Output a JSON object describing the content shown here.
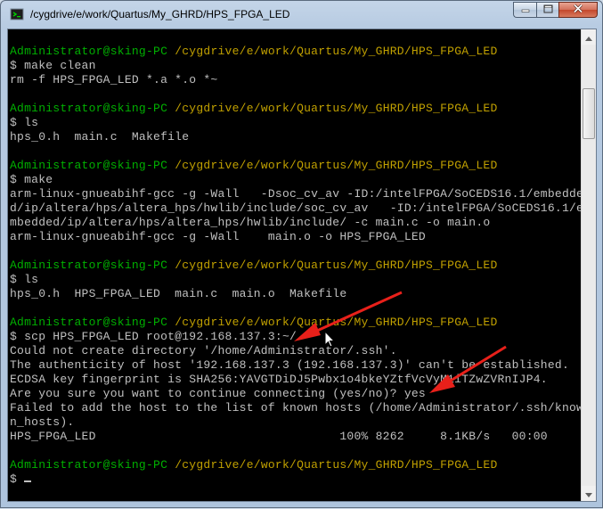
{
  "window": {
    "title": "/cygdrive/e/work/Quartus/My_GHRD/HPS_FPGA_LED",
    "icon": "cygwin-terminal-icon",
    "controls": [
      "minimize-icon",
      "maximize-icon",
      "close-icon"
    ]
  },
  "terminal": {
    "lines": [
      {
        "user": "Administrator@sking-PC",
        "path": "/cygdrive/e/work/Quartus/My_GHRD/HPS_FPGA_LED"
      },
      {
        "text": "$ make clean"
      },
      {
        "text": "rm -f HPS_FPGA_LED *.a *.o *~"
      },
      {
        "text": ""
      },
      {
        "user": "Administrator@sking-PC",
        "path": "/cygdrive/e/work/Quartus/My_GHRD/HPS_FPGA_LED"
      },
      {
        "text": "$ ls"
      },
      {
        "text": "hps_0.h  main.c  Makefile"
      },
      {
        "text": ""
      },
      {
        "user": "Administrator@sking-PC",
        "path": "/cygdrive/e/work/Quartus/My_GHRD/HPS_FPGA_LED"
      },
      {
        "text": "$ make"
      },
      {
        "text": "arm-linux-gnueabihf-gcc -g -Wall   -Dsoc_cv_av -ID:/intelFPGA/SoCEDS16.1/embedde"
      },
      {
        "text": "d/ip/altera/hps/altera_hps/hwlib/include/soc_cv_av   -ID:/intelFPGA/SoCEDS16.1/e"
      },
      {
        "text": "mbedded/ip/altera/hps/altera_hps/hwlib/include/ -c main.c -o main.o"
      },
      {
        "text": "arm-linux-gnueabihf-gcc -g -Wall    main.o -o HPS_FPGA_LED"
      },
      {
        "text": ""
      },
      {
        "user": "Administrator@sking-PC",
        "path": "/cygdrive/e/work/Quartus/My_GHRD/HPS_FPGA_LED"
      },
      {
        "text": "$ ls"
      },
      {
        "text": "hps_0.h  HPS_FPGA_LED  main.c  main.o  Makefile"
      },
      {
        "text": ""
      },
      {
        "user": "Administrator@sking-PC",
        "path": "/cygdrive/e/work/Quartus/My_GHRD/HPS_FPGA_LED"
      },
      {
        "text": "$ scp HPS_FPGA_LED root@192.168.137.3:~/"
      },
      {
        "text": "Could not create directory '/home/Administrator/.ssh'."
      },
      {
        "text": "The authenticity of host '192.168.137.3 (192.168.137.3)' can't be established."
      },
      {
        "text": "ECDSA key fingerprint is SHA256:YAVGTDiDJ5Pwbx1o4bkeYZtfVcVyM1iTZwZVRnIJP4."
      },
      {
        "text": "Are you sure you want to continue connecting (yes/no)? yes"
      },
      {
        "text": "Failed to add the host to the list of known hosts (/home/Administrator/.ssh/know"
      },
      {
        "text": "n_hosts)."
      },
      {
        "text": "HPS_FPGA_LED                                  100% 8262     8.1KB/s   00:00"
      },
      {
        "text": ""
      },
      {
        "user": "Administrator@sking-PC",
        "path": "/cygdrive/e/work/Quartus/My_GHRD/HPS_FPGA_LED"
      },
      {
        "text": "$ ",
        "cursor": true
      }
    ]
  },
  "colors": {
    "user": "#00b000",
    "path": "#c0a000",
    "text": "#c0c0c0",
    "background": "#000000",
    "annotation_arrow": "#e8201a"
  },
  "annotations": [
    "red-arrow-icon",
    "red-arrow-icon",
    "mouse-pointer-icon"
  ]
}
